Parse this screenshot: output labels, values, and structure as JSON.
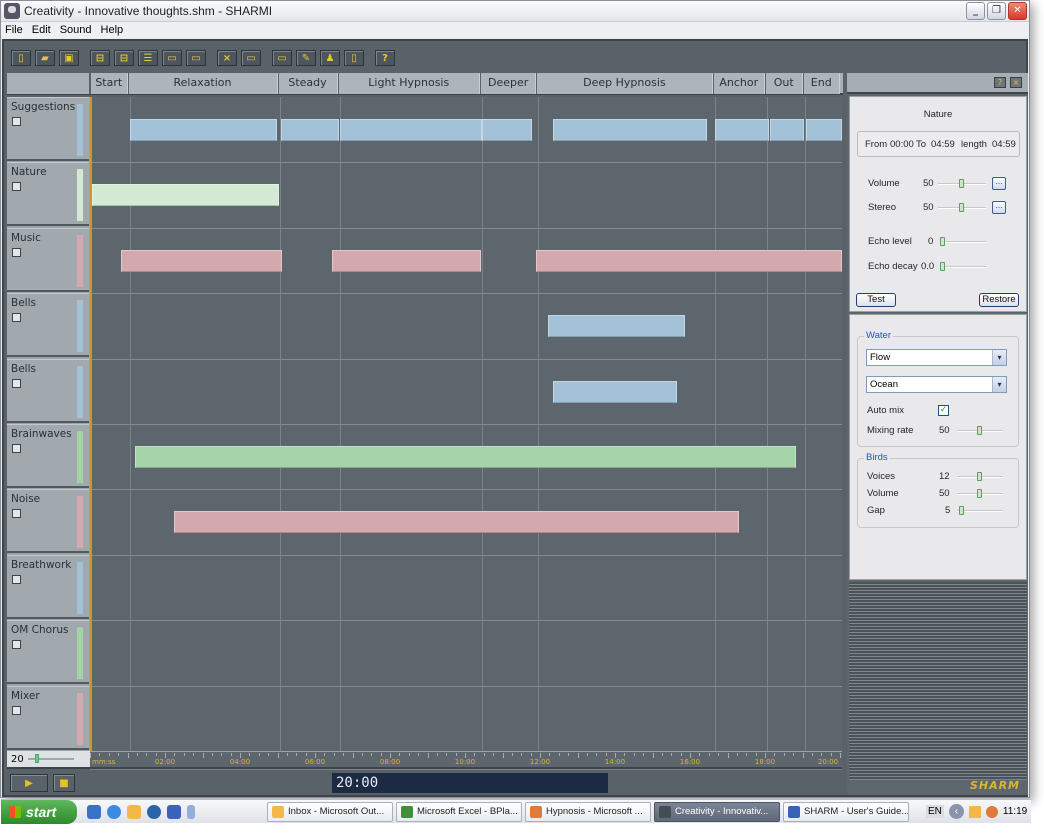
{
  "window": {
    "title": "Creativity - Innovative thoughts.shm - SHARMI",
    "controls": [
      "minimize",
      "restore",
      "close"
    ]
  },
  "menu": [
    "File",
    "Edit",
    "Sound",
    "Help"
  ],
  "toolbar": [
    {
      "name": "new-icon",
      "glyph": "▯"
    },
    {
      "name": "open-icon",
      "glyph": "▰"
    },
    {
      "name": "save-icon",
      "glyph": "▣"
    },
    {
      "name": "insert-track-before-icon",
      "glyph": "⊟"
    },
    {
      "name": "insert-track-after-icon",
      "glyph": "⊟"
    },
    {
      "name": "add-track-icon",
      "glyph": "☰"
    },
    {
      "name": "track-icon",
      "glyph": "▭"
    },
    {
      "name": "track-empty-icon",
      "glyph": "▭"
    },
    {
      "name": "delete-icon",
      "glyph": "×"
    },
    {
      "name": "window-icon",
      "glyph": "▭"
    },
    {
      "name": "properties-icon",
      "glyph": "▭"
    },
    {
      "name": "tools-icon",
      "glyph": "✎"
    },
    {
      "name": "user-icon",
      "glyph": "♟"
    },
    {
      "name": "info-icon",
      "glyph": "▯"
    },
    {
      "name": "help-icon",
      "glyph": "?"
    }
  ],
  "sections": [
    {
      "label": "Start",
      "from": 0.0,
      "to": 1.0
    },
    {
      "label": "Relaxation",
      "from": 1.0,
      "to": 5.0
    },
    {
      "label": "Steady",
      "from": 5.0,
      "to": 6.6
    },
    {
      "label": "Light Hypnosis",
      "from": 6.6,
      "to": 10.4
    },
    {
      "label": "Deeper",
      "from": 10.4,
      "to": 11.9
    },
    {
      "label": "Deep Hypnosis",
      "from": 11.9,
      "to": 16.6
    },
    {
      "label": "Anchor",
      "from": 16.6,
      "to": 18.0
    },
    {
      "label": "Out",
      "from": 18.0,
      "to": 19.0
    },
    {
      "label": "End",
      "from": 19.0,
      "to": 20.0
    }
  ],
  "tracks": [
    {
      "name": "Suggestions",
      "color": "#a3c1d7",
      "clips": [
        [
          1.0,
          4.93
        ],
        [
          5.03,
          6.58
        ],
        [
          6.6,
          10.39
        ],
        [
          10.41,
          11.74
        ],
        [
          12.3,
          16.4
        ],
        [
          16.62,
          18.06
        ],
        [
          18.08,
          18.99
        ],
        [
          19.04,
          20.0
        ]
      ]
    },
    {
      "name": "Nature",
      "color": "#d4ead4",
      "clips": [
        [
          0.0,
          4.98
        ]
      ]
    },
    {
      "name": "Music",
      "color": "#d4a9ae",
      "clips": [
        [
          0.77,
          5.06
        ],
        [
          6.39,
          10.36
        ],
        [
          11.85,
          20.0
        ]
      ]
    },
    {
      "name": "Bells",
      "color": "#a3c1d7",
      "clips": [
        [
          12.17,
          15.82
        ]
      ]
    },
    {
      "name": "Bells",
      "color": "#a3c1d7",
      "clips": [
        [
          12.28,
          15.6
        ]
      ]
    },
    {
      "name": "Brainwaves",
      "color": "#a3d3a7",
      "clips": [
        [
          1.15,
          18.77
        ]
      ]
    },
    {
      "name": "Noise",
      "color": "#d4a9ae",
      "clips": [
        [
          2.18,
          17.26
        ]
      ]
    },
    {
      "name": "Breathwork",
      "color": "#a3c1d7",
      "clips": []
    },
    {
      "name": "OM Chorus",
      "color": "#a3d3a7",
      "clips": []
    },
    {
      "name": "Mixer",
      "color": "#d4a9ae",
      "clips": []
    }
  ],
  "timeline": {
    "total_minutes": 20,
    "unit_label": "mm:ss",
    "tick_labels": [
      "02:00",
      "04:00",
      "06:00",
      "08:00",
      "10:00",
      "12:00",
      "14:00",
      "16:00",
      "18:00",
      "20:00"
    ],
    "zoom_value": "20",
    "current_time": "20:00"
  },
  "transport": {
    "play": "▶",
    "stop": "■"
  },
  "properties": {
    "header_buttons": [
      "?",
      "×"
    ],
    "title": "Nature",
    "range": {
      "from_label": "From",
      "from": "00:00",
      "to_label": "To",
      "to": "04:59",
      "length_label": "length",
      "length": "04:59"
    },
    "volume": {
      "label": "Volume",
      "value": "50",
      "level": 0.5
    },
    "stereo": {
      "label": "Stereo",
      "value": "50",
      "level": 0.5
    },
    "echo_level": {
      "label": "Echo level",
      "value": "0",
      "level": 0.0
    },
    "echo_decay": {
      "label": "Echo decay",
      "value": "0.0",
      "level": 0.0
    },
    "more_button": "...",
    "test_button": "Test",
    "restore_button": "Restore"
  },
  "water": {
    "title": "Water",
    "type_select": "Flow",
    "sound_select": "Ocean",
    "auto_mix_label": "Auto mix",
    "auto_mix_checked": true,
    "mixing_rate": {
      "label": "Mixing rate",
      "value": "50",
      "level": 0.5
    }
  },
  "birds": {
    "title": "Birds",
    "voices": {
      "label": "Voices",
      "value": "12",
      "level": 0.5
    },
    "volume": {
      "label": "Volume",
      "value": "50",
      "level": 0.5
    },
    "gap": {
      "label": "Gap",
      "value": "5",
      "level": 0.05
    }
  },
  "brand": "SHARM",
  "taskbar": {
    "start": "start",
    "tasks": [
      {
        "label": "Inbox - Microsoft Out...",
        "color": "#f2b84a",
        "active": false
      },
      {
        "label": "Microsoft Excel - BPla...",
        "color": "#3f8f3a",
        "active": false
      },
      {
        "label": "Hypnosis - Microsoft ...",
        "color": "#e07a3a",
        "active": false
      },
      {
        "label": "Creativity - Innovativ...",
        "color": "#444c55",
        "active": true
      },
      {
        "label": "SHARM - User's Guide...",
        "color": "#3a62b8",
        "active": false
      }
    ],
    "lang": "EN",
    "clock": "11:19"
  }
}
